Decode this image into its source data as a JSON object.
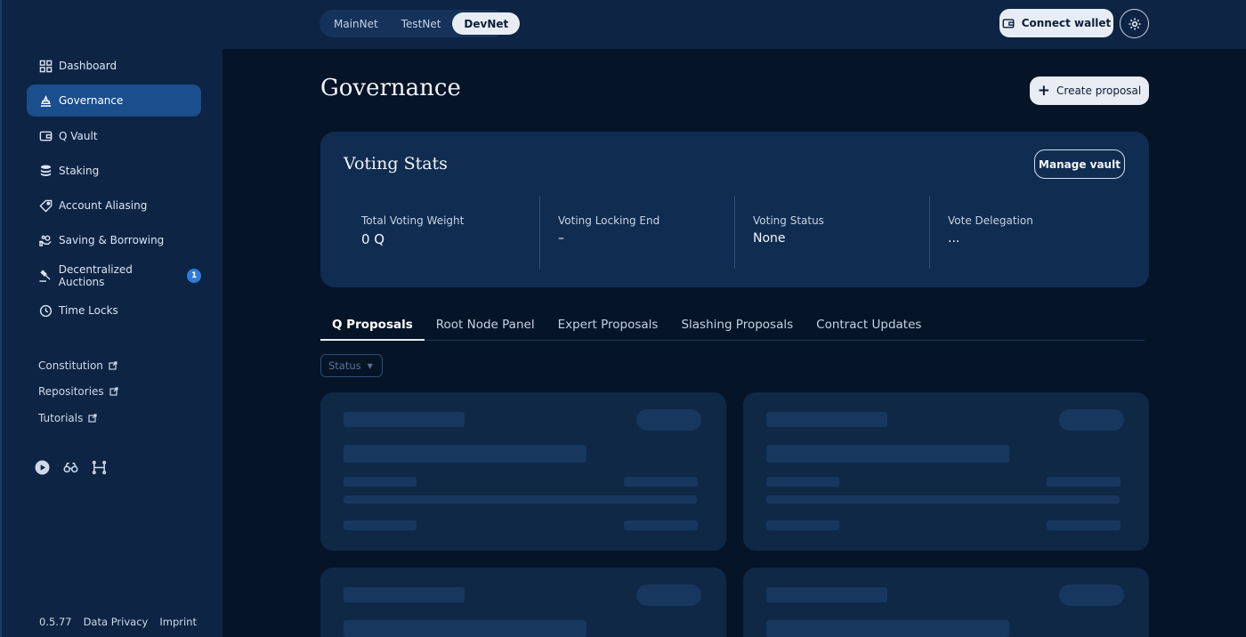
{
  "topbar": {
    "networks": [
      "MainNet",
      "TestNet",
      "DevNet"
    ],
    "active_network": "DevNet",
    "connect_wallet": "Connect wallet"
  },
  "sidebar": {
    "items": [
      {
        "label": "Dashboard",
        "icon": "dashboard-icon"
      },
      {
        "label": "Governance",
        "icon": "governance-icon"
      },
      {
        "label": "Q Vault",
        "icon": "wallet-icon"
      },
      {
        "label": "Staking",
        "icon": "coins-icon"
      },
      {
        "label": "Account Aliasing",
        "icon": "tag-icon"
      },
      {
        "label": "Saving & Borrowing",
        "icon": "hand-coin-icon"
      },
      {
        "label": "Decentralized Auctions",
        "icon": "gavel-icon",
        "badge": "1"
      },
      {
        "label": "Time Locks",
        "icon": "clock-icon"
      }
    ],
    "active": "Governance",
    "links": [
      "Constitution",
      "Repositories",
      "Tutorials"
    ],
    "socials": [
      "play-icon",
      "binoculars-icon",
      "network-icon"
    ],
    "footer": {
      "version": "0.5.77",
      "privacy": "Data Privacy",
      "imprint": "Imprint"
    }
  },
  "main": {
    "title": "Governance",
    "create_proposal": "Create proposal",
    "voting_stats": {
      "title": "Voting Stats",
      "manage_vault": "Manage vault",
      "items": [
        {
          "label": "Total Voting Weight",
          "value": "0 Q"
        },
        {
          "label": "Voting Locking End",
          "value": "–"
        },
        {
          "label": "Voting Status",
          "value": "None"
        },
        {
          "label": "Vote Delegation",
          "value": "..."
        }
      ]
    },
    "tabs": [
      "Q Proposals",
      "Root Node Panel",
      "Expert Proposals",
      "Slashing Proposals",
      "Contract Updates"
    ],
    "active_tab": "Q Proposals",
    "status_filter": "Status"
  },
  "colors": {
    "sidebar_bg": "#0d2445",
    "page_bg": "#061428",
    "card_bg": "#102c50",
    "active_nav": "#1a4e8c",
    "badge": "#2f7bdd",
    "button_light": "#e8edf4"
  }
}
